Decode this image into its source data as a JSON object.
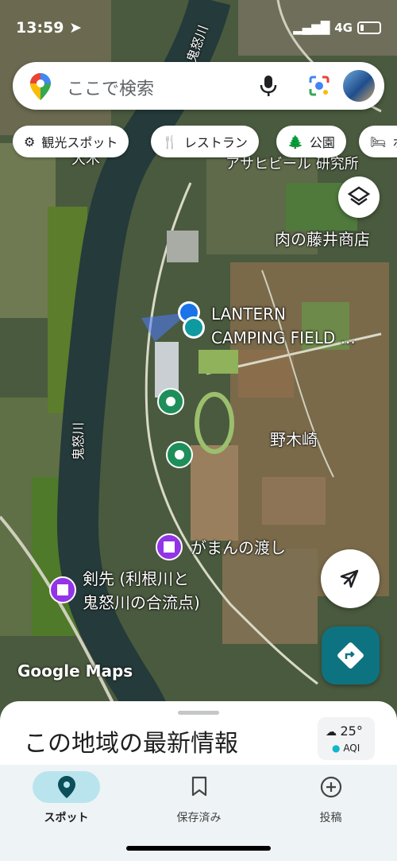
{
  "status_bar": {
    "time": "13:59",
    "network": "4G"
  },
  "search": {
    "placeholder": "ここで検索"
  },
  "chips": [
    "観光スポット",
    "レストラン",
    "公園",
    "ホ"
  ],
  "map_labels": {
    "lantern_line1": "LANTERN",
    "lantern_line2": "CAMPING FIELD ...",
    "asahi": "アサヒビール 研究所",
    "niku": "肉の藤井商店",
    "nogisaki": "野木崎",
    "gaman": "がまんの渡し",
    "kensaki_line1": "剣先 (利根川と",
    "kensaki_line2": "鬼怒川の合流点)",
    "kinugawa_top": "鬼怒川",
    "kinugawa_mid": "鬼怒川",
    "omura": "大木"
  },
  "map_logo": "Google Maps",
  "sheet": {
    "title": "この地域の最新情報"
  },
  "weather": {
    "temp": "25°",
    "aqi": "AQI"
  },
  "bottom_nav": [
    {
      "label": "スポット"
    },
    {
      "label": "保存済み"
    },
    {
      "label": "投稿"
    }
  ],
  "colors": {
    "accent": "#0e7380",
    "nav_active_pill": "#b9e4ee",
    "location_dot": "#1a73e8",
    "green_pin": "#1e8e5a",
    "purple_pin": "#9334e6"
  }
}
